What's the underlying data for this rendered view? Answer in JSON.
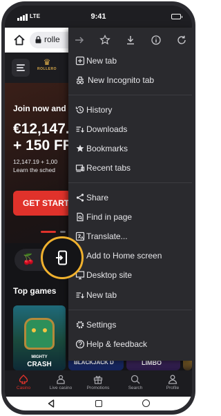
{
  "status_bar": {
    "network": "LTE",
    "time": "9:41"
  },
  "browser": {
    "url_text": "rolle"
  },
  "site": {
    "logo_text": "ROLLERO",
    "banner": {
      "headline": "Join now and g",
      "amount_line1": "€12,147.",
      "amount_line2": "+ 150 FR",
      "sub_line1": "12,147.19 + 1,00",
      "sub_line2": "Learn the sched",
      "cta_label": "GET START"
    },
    "section_title": "Top games",
    "games": [
      {
        "small": "MIGHTY",
        "big": "CRASH"
      },
      {
        "label": "BLACKJACK D"
      },
      {
        "label": "LIMBO"
      }
    ],
    "bottom_nav": [
      {
        "label": "Casino",
        "active": true
      },
      {
        "label": "Live casino"
      },
      {
        "label": "Promotions"
      },
      {
        "label": "Search"
      },
      {
        "label": "Profile"
      }
    ]
  },
  "menu": {
    "icon_row": [
      "forward-icon",
      "bookmark-star-icon",
      "download-icon",
      "info-icon",
      "refresh-icon"
    ],
    "items": [
      {
        "label": "New tab",
        "icon": "new-tab-icon"
      },
      {
        "label": "New Incognito tab",
        "icon": "incognito-icon"
      },
      {
        "label": "History",
        "icon": "history-icon"
      },
      {
        "label": "Downloads",
        "icon": "downloads-icon"
      },
      {
        "label": "Bookmarks",
        "icon": "bookmarks-icon"
      },
      {
        "label": "Recent tabs",
        "icon": "recent-tabs-icon"
      },
      {
        "label": "Share",
        "icon": "share-icon"
      },
      {
        "label": "Find in page",
        "icon": "find-in-page-icon"
      },
      {
        "label": "Translate...",
        "icon": "translate-icon"
      },
      {
        "label": "Add to Home screen",
        "icon": "add-to-home-icon"
      },
      {
        "label": "Desktop site",
        "icon": "desktop-site-icon"
      },
      {
        "label": "New tab",
        "icon": "new-tab-list-icon"
      },
      {
        "label": "Settings",
        "icon": "settings-icon"
      },
      {
        "label": "Help & feedback",
        "icon": "help-icon"
      }
    ]
  },
  "colors": {
    "accent_red": "#e0322b",
    "highlight_ring": "#f0b12e",
    "menu_bg": "#2a2a2e"
  }
}
